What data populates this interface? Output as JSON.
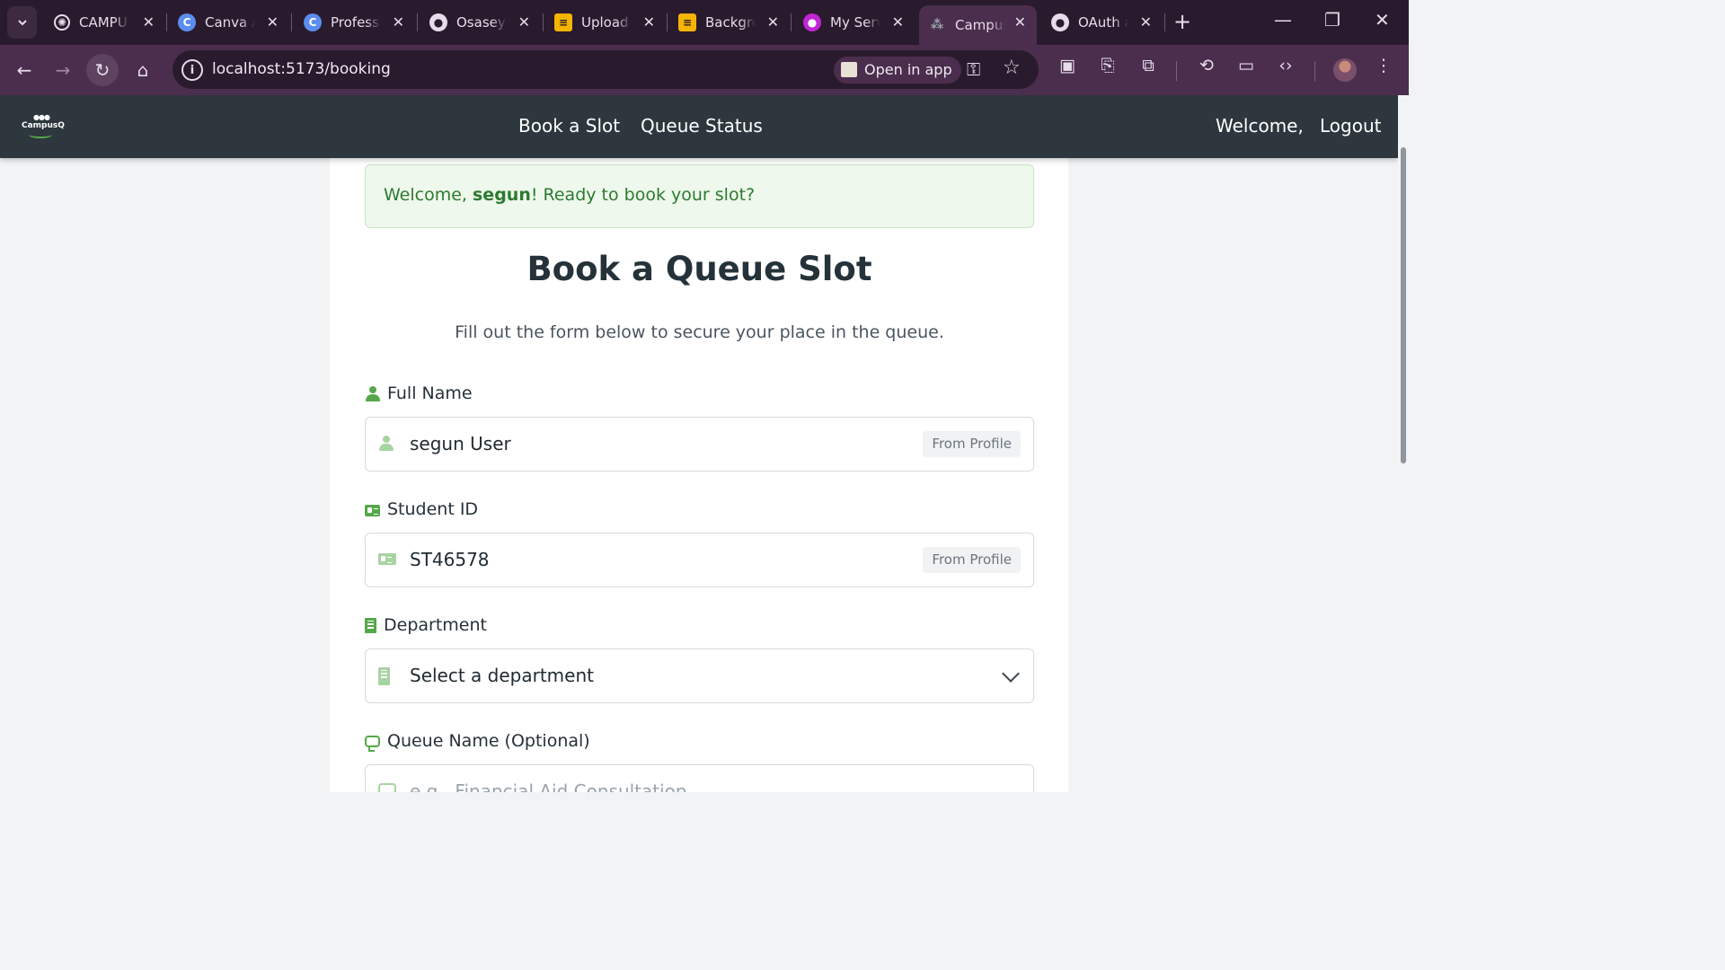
{
  "browser": {
    "tabs": [
      {
        "title": "CAMPUS",
        "favicon": "openai-icon",
        "color": "#e6dcea"
      },
      {
        "title": "Canva AI",
        "favicon": "canva-icon",
        "color": "#5b8def"
      },
      {
        "title": "Professional",
        "favicon": "canva-icon",
        "color": "#5b8def"
      },
      {
        "title": "Osaseye",
        "favicon": "github-icon",
        "color": "#e6dcea"
      },
      {
        "title": "Upload",
        "favicon": "layers-icon",
        "color": "#f4b400"
      },
      {
        "title": "Background",
        "favicon": "layers-icon",
        "color": "#f4b400"
      },
      {
        "title": "My Services",
        "favicon": "app-icon",
        "color": "#c026d3"
      },
      {
        "title": "Campus",
        "favicon": "campusq-icon",
        "color": "#9aa4ac"
      },
      {
        "title": "OAuth app",
        "favicon": "github-icon",
        "color": "#e6dcea"
      }
    ],
    "url": "localhost:5173/booking",
    "open_in_app": "Open in app"
  },
  "nav": {
    "logo_text": "CampusQ",
    "links": [
      "Book a Slot",
      "Queue Status"
    ],
    "welcome": "Welcome,",
    "logout": "Logout"
  },
  "alert": {
    "prefix": "Welcome, ",
    "username": "segun",
    "suffix": "! Ready to book your slot?"
  },
  "form": {
    "title": "Book a Queue Slot",
    "subtitle": "Fill out the form below to secure your place in the queue.",
    "full_name": {
      "label": "Full Name",
      "value": "segun User",
      "badge": "From Profile"
    },
    "student_id": {
      "label": "Student ID",
      "value": "ST46578",
      "badge": "From Profile"
    },
    "department": {
      "label": "Department",
      "value": "Select a department"
    },
    "queue_name": {
      "label": "Queue Name (Optional)",
      "placeholder": "e.g., Financial Aid Consultation"
    }
  },
  "colors": {
    "nav_bg": "#2d373d",
    "accent_green": "#55a84a",
    "alert_text": "#2c7a2f",
    "browser_frame": "#4b2e4d"
  }
}
